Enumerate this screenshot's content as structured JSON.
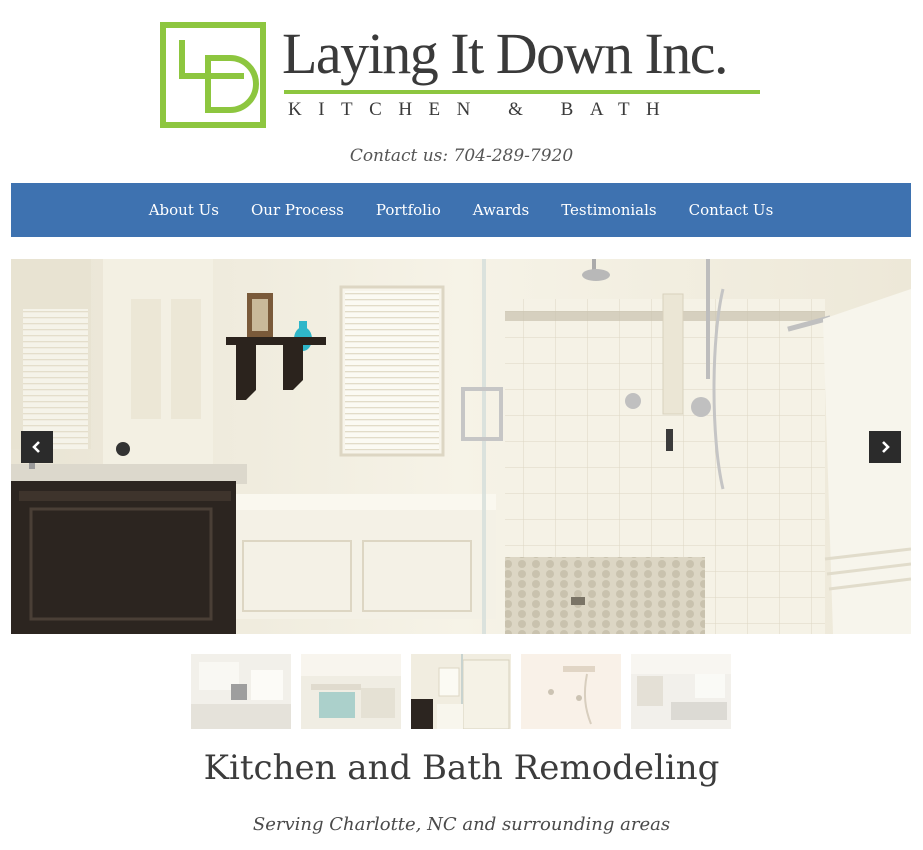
{
  "brand": {
    "name": "Laying It Down Inc.",
    "tagline": "KITCHEN & BATH",
    "accent_color": "#8dc63f",
    "logo_icon": "ld-monogram-icon"
  },
  "contact": {
    "text": "Contact us: 704-289-7920"
  },
  "nav": {
    "color": "#3e72b0",
    "items": [
      "About Us",
      "Our Process",
      "Portfolio",
      "Awards",
      "Testimonials",
      "Contact Us"
    ]
  },
  "slider": {
    "prev_icon": "chevron-left-icon",
    "next_icon": "chevron-right-icon",
    "thumbnail_count": 5,
    "active_thumbnail": 3
  },
  "main": {
    "headline": "Kitchen and Bath Remodeling",
    "subheadline": "Serving Charlotte, NC and surrounding areas"
  }
}
